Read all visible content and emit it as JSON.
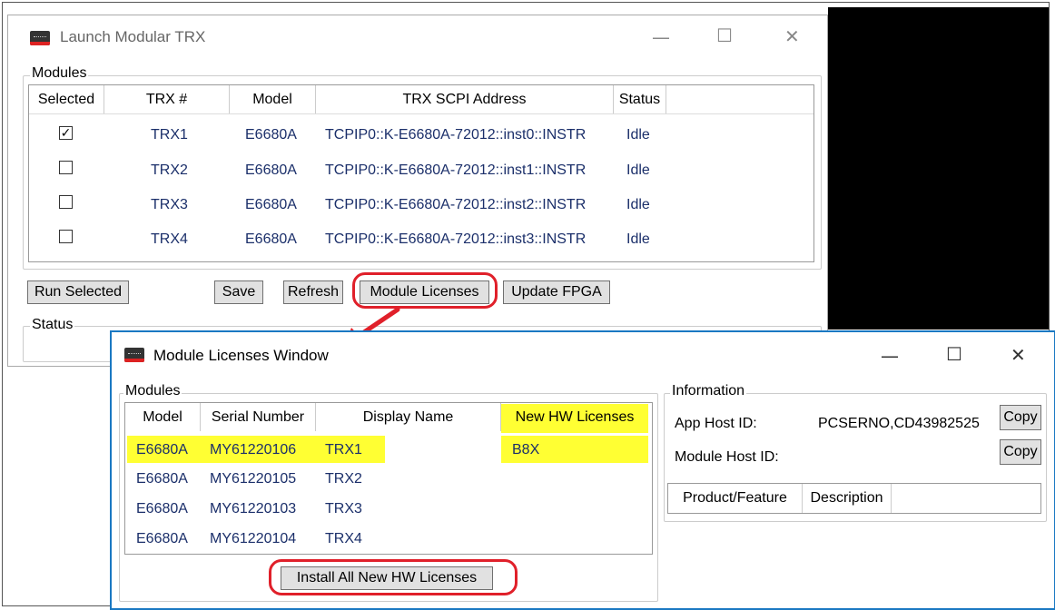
{
  "launch_window": {
    "title": "Launch Modular TRX",
    "modules_label": "Modules",
    "columns": [
      "Selected",
      "TRX #",
      "Model",
      "TRX SCPI Address",
      "Status"
    ],
    "rows": [
      {
        "selected": true,
        "check": "✓",
        "trx": "TRX1",
        "model": "E6680A",
        "address": "TCPIP0::K-E6680A-72012::inst0::INSTR",
        "status": "Idle"
      },
      {
        "selected": false,
        "check": "",
        "trx": "TRX2",
        "model": "E6680A",
        "address": "TCPIP0::K-E6680A-72012::inst1::INSTR",
        "status": "Idle"
      },
      {
        "selected": false,
        "check": "",
        "trx": "TRX3",
        "model": "E6680A",
        "address": "TCPIP0::K-E6680A-72012::inst2::INSTR",
        "status": "Idle"
      },
      {
        "selected": false,
        "check": "",
        "trx": "TRX4",
        "model": "E6680A",
        "address": "TCPIP0::K-E6680A-72012::inst3::INSTR",
        "status": "Idle"
      }
    ],
    "buttons": {
      "run_selected": "Run Selected",
      "save": "Save",
      "refresh": "Refresh",
      "module_licenses": "Module Licenses",
      "update_fpga": "Update FPGA"
    },
    "status_label": "Status"
  },
  "licenses_window": {
    "title": "Module Licenses Window",
    "modules_label": "Modules",
    "columns": [
      "Model",
      "Serial Number",
      "Display Name",
      "New HW Licenses"
    ],
    "rows": [
      {
        "model": "E6680A",
        "serial": "MY61220106",
        "display": "TRX1",
        "licenses": "B8X"
      },
      {
        "model": "E6680A",
        "serial": "MY61220105",
        "display": "TRX2",
        "licenses": ""
      },
      {
        "model": "E6680A",
        "serial": "MY61220103",
        "display": "TRX3",
        "licenses": ""
      },
      {
        "model": "E6680A",
        "serial": "MY61220104",
        "display": "TRX4",
        "licenses": ""
      }
    ],
    "install_button": "Install All New HW Licenses",
    "information": {
      "label": "Information",
      "app_host_label": "App Host ID:",
      "app_host_value": "PCSERNO,CD43982525",
      "module_host_label": "Module Host ID:",
      "copy_label": "Copy",
      "table_columns": [
        "Product/Feature",
        "Description"
      ]
    }
  },
  "window_controls": {
    "minimize": "—",
    "maximize": "☐",
    "close": "✕"
  },
  "colors": {
    "highlight": "#ffff33",
    "callout": "#e0202a",
    "active_border": "#1a78c2"
  }
}
